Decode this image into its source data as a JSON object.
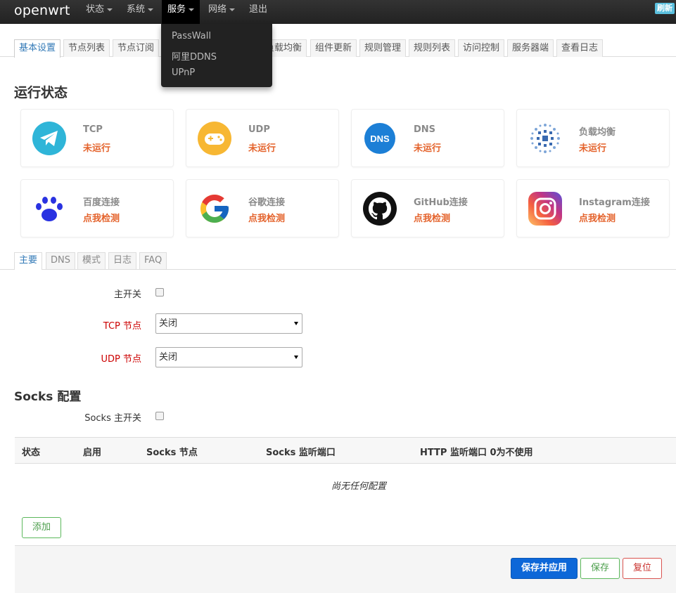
{
  "navbar": {
    "brand": "openwrt",
    "items": [
      {
        "label": "状态",
        "caret": true
      },
      {
        "label": "系统",
        "caret": true
      },
      {
        "label": "服务",
        "caret": true
      },
      {
        "label": "网络",
        "caret": true
      },
      {
        "label": "退出",
        "caret": false
      }
    ],
    "refresh": "刷新"
  },
  "dropdown": {
    "items": [
      "PassWall",
      "阿里DDNS",
      "UPnP"
    ]
  },
  "tabs": [
    "基本设置",
    "节点列表",
    "节点订阅",
    "",
    "负载均衡",
    "组件更新",
    "规则管理",
    "规则列表",
    "访问控制",
    "服务器端",
    "查看日志"
  ],
  "section_status": "运行状态",
  "cards": [
    {
      "icon": "telegram-icon",
      "title": "TCP",
      "status": "未运行"
    },
    {
      "icon": "gamepad-icon",
      "title": "UDP",
      "status": "未运行"
    },
    {
      "icon": "dns-icon",
      "icon_text": "DNS",
      "title": "DNS",
      "status": "未运行"
    },
    {
      "icon": "load-balance-icon",
      "title": "负载均衡",
      "status": "未运行"
    },
    {
      "icon": "baidu-paw-icon",
      "title": "百度连接",
      "status": "点我检测"
    },
    {
      "icon": "google-icon",
      "title": "谷歌连接",
      "status": "点我检测"
    },
    {
      "icon": "github-icon",
      "title": "GitHub连接",
      "status": "点我检测"
    },
    {
      "icon": "instagram-icon",
      "title": "Instagram连接",
      "status": "点我检测"
    }
  ],
  "subtabs": [
    "主要",
    "DNS",
    "模式",
    "日志",
    "FAQ"
  ],
  "form": {
    "main_switch": "主开关",
    "tcp_node": "TCP 节点",
    "tcp_value": "关闭",
    "udp_node": "UDP 节点",
    "udp_value": "关闭"
  },
  "socks": {
    "title": "Socks 配置",
    "switch": "Socks 主开关",
    "columns": [
      "状态",
      "启用",
      "Socks 节点",
      "Socks 监听端口",
      "HTTP 监听端口 0为不使用"
    ],
    "empty": "尚无任何配置",
    "add": "添加"
  },
  "footer": {
    "apply": "保存并应用",
    "save": "保存",
    "reset": "复位"
  },
  "colors": {
    "status_text": "#e4632c",
    "active_tab": "#337ab7",
    "apply_button": "#0d67d8"
  }
}
